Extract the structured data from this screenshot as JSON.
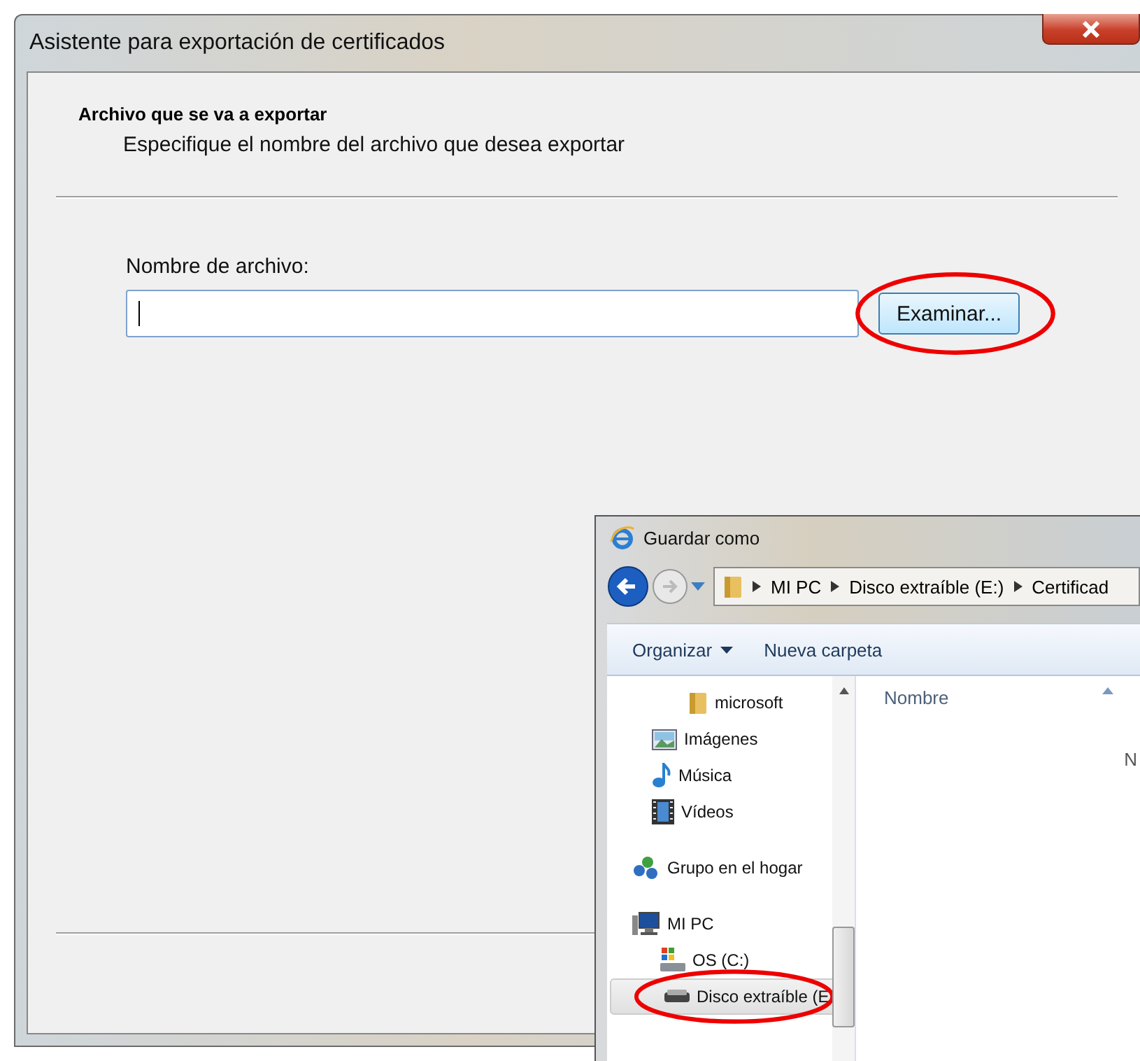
{
  "window": {
    "title": "Asistente para exportación de certificados"
  },
  "header": {
    "title": "Archivo que se va a exportar",
    "subtitle": "Especifique el nombre del archivo que desea exportar"
  },
  "file_field": {
    "label": "Nombre de archivo:",
    "focused": true
  },
  "browse_button": {
    "label": "Examinar...",
    "highlighted": true
  },
  "save_dialog": {
    "title": "Guardar como",
    "breadcrumb": [
      "MI PC",
      "Disco extraíble (E:)",
      "Certificad"
    ],
    "toolbar": [
      "Organizar",
      "Nueva carpeta"
    ],
    "tree": [
      {
        "label": "microsoft",
        "kind": "folder",
        "selected": false
      },
      {
        "label": "Imágenes",
        "kind": "pictures",
        "selected": false
      },
      {
        "label": "Música",
        "kind": "music",
        "selected": false
      },
      {
        "label": "Vídeos",
        "kind": "videos",
        "selected": false
      },
      {
        "label": "Grupo en el hogar",
        "kind": "homegroup",
        "selected": false
      },
      {
        "label": "MI PC",
        "kind": "computer",
        "selected": false,
        "children": [
          {
            "label": "OS (C:)",
            "kind": "system-drive",
            "selected": false
          },
          {
            "label": "Disco extraíble (E",
            "kind": "removable-drive",
            "selected": true,
            "highlighted": true
          }
        ]
      }
    ],
    "column": "Nombre",
    "empty_message": "N"
  }
}
